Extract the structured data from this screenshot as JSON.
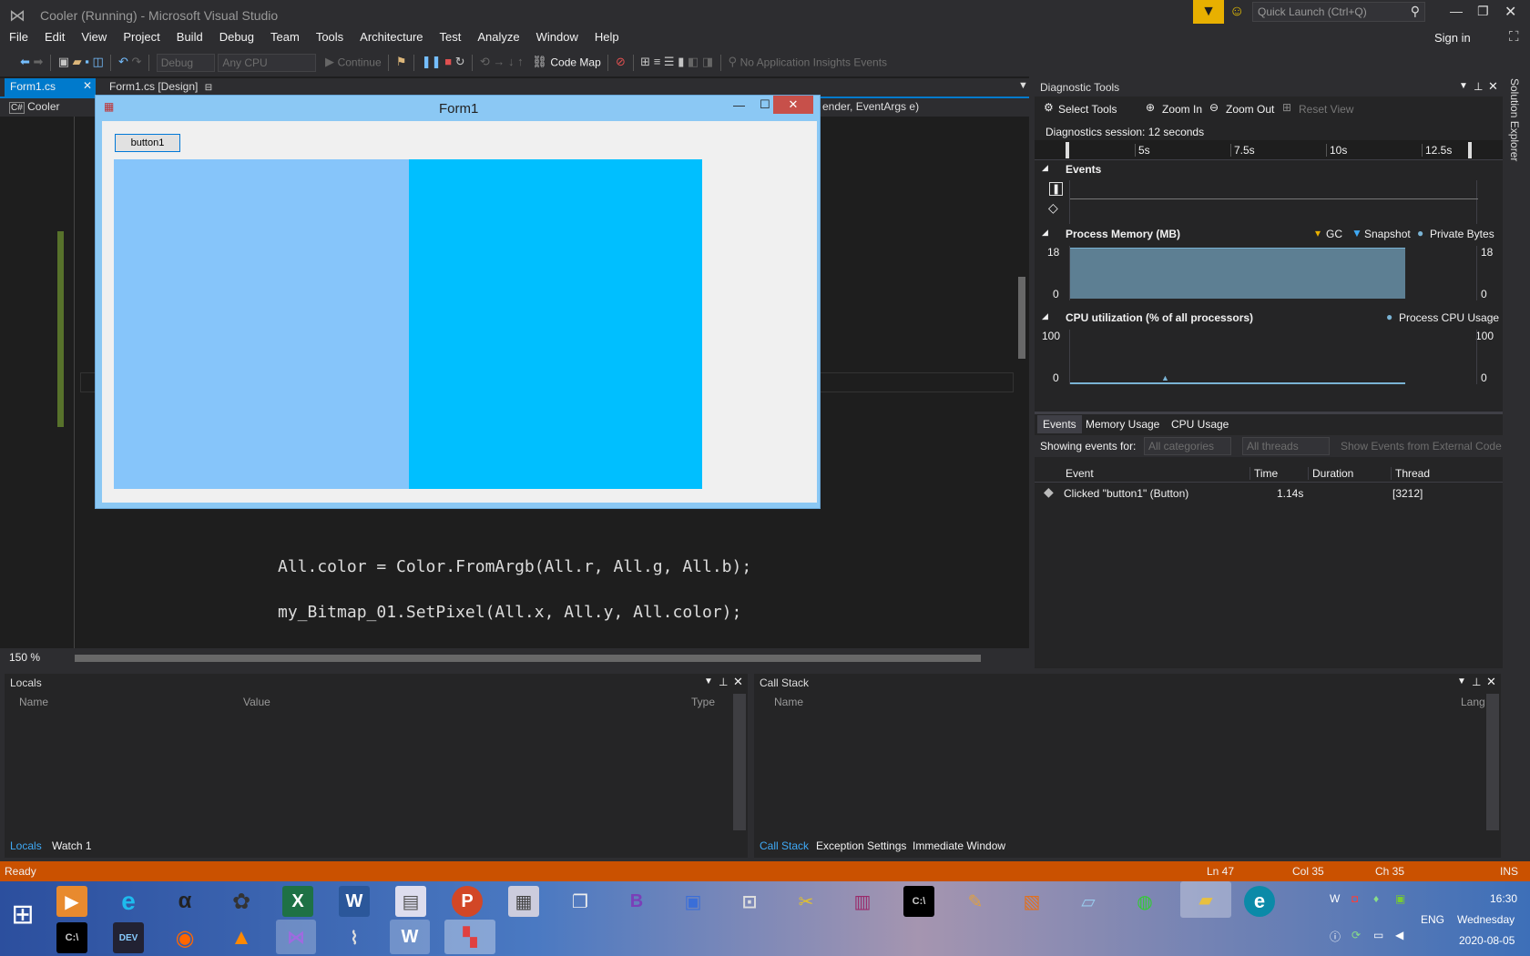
{
  "window": {
    "title": "Cooler (Running) - Microsoft Visual Studio",
    "quick_launch_placeholder": "Quick Launch (Ctrl+Q)",
    "sign_in": "Sign in"
  },
  "menu": {
    "items": [
      "File",
      "Edit",
      "View",
      "Project",
      "Build",
      "Debug",
      "Team",
      "Tools",
      "Architecture",
      "Test",
      "Analyze",
      "Window",
      "Help"
    ]
  },
  "toolbar": {
    "config": "Debug",
    "platform": "Any CPU",
    "continue": "Continue",
    "code_map": "Code Map",
    "insights": "No Application Insights Events"
  },
  "editor": {
    "tabs": [
      {
        "label": "Form1.cs"
      },
      {
        "label": "Form1.cs [Design]"
      }
    ],
    "project_dropdown": "Cooler",
    "member_dropdown": "ender, EventArgs e)",
    "zoom": "150 %",
    "code_lines": [
      "All.color = Color.FromArgb(All.r, All.g, All.b);",
      "my_Bitmap_01.SetPixel(All.x, All.y, All.color);"
    ]
  },
  "form": {
    "title": "Form1",
    "button_label": "button1",
    "panel_left_color": "#86c5fa",
    "panel_right_color": "#00bfff"
  },
  "diagnostic": {
    "title": "Diagnostic Tools",
    "select_tools": "Select Tools",
    "zoom_in": "Zoom In",
    "zoom_out": "Zoom Out",
    "reset_view": "Reset View",
    "session": "Diagnostics session: 12 seconds",
    "timeline_ticks": [
      "5s",
      "7.5s",
      "10s",
      "12.5s"
    ],
    "events_label": "Events",
    "memory_title": "Process Memory (MB)",
    "memory_legend": [
      "GC",
      "Snapshot",
      "Private Bytes"
    ],
    "memory_max": "18",
    "memory_min": "0",
    "cpu_title": "CPU utilization (% of all processors)",
    "cpu_legend": "Process CPU Usage",
    "cpu_max": "100",
    "cpu_min": "0",
    "tabs": [
      "Events",
      "Memory Usage",
      "CPU Usage"
    ],
    "showing_label": "Showing events for:",
    "filter_categories": "All categories",
    "filter_threads": "All threads",
    "external_code": "Show Events from External Code",
    "columns": [
      "Event",
      "Time",
      "Duration",
      "Thread"
    ],
    "rows": [
      {
        "event": "Clicked \"button1\" (Button)",
        "time": "1.14s",
        "duration": "",
        "thread": "[3212]"
      }
    ]
  },
  "locals": {
    "title": "Locals",
    "columns": [
      "Name",
      "Value",
      "Type"
    ],
    "tabs": [
      "Locals",
      "Watch 1"
    ]
  },
  "callstack": {
    "title": "Call Stack",
    "columns": [
      "Name",
      "Lang"
    ],
    "tabs": [
      "Call Stack",
      "Exception Settings",
      "Immediate Window"
    ]
  },
  "side_tab": "Solution Explorer",
  "status": {
    "ready": "Ready",
    "ln": "Ln 47",
    "col": "Col 35",
    "ch": "Ch 35",
    "ins": "INS"
  },
  "taskbar": {
    "lang": "ENG",
    "time": "16:30",
    "day": "Wednesday",
    "date": "2020-08-05"
  }
}
